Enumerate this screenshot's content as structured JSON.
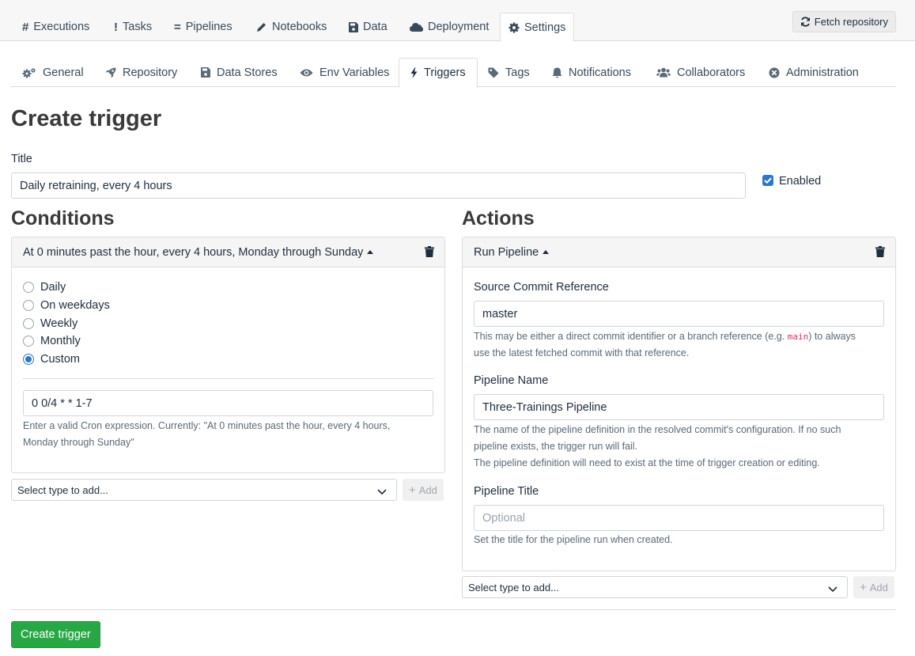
{
  "top_nav": {
    "tabs": [
      {
        "label": "Executions",
        "icon": "hash-icon"
      },
      {
        "label": "Tasks",
        "icon": "exclamation-icon"
      },
      {
        "label": "Pipelines",
        "icon": "equals-icon"
      },
      {
        "label": "Notebooks",
        "icon": "pencil-icon"
      },
      {
        "label": "Data",
        "icon": "floppy-disk-icon"
      },
      {
        "label": "Deployment",
        "icon": "cloud-icon"
      },
      {
        "label": "Settings",
        "icon": "gear-icon"
      }
    ],
    "active": "Settings",
    "fetch_button": "Fetch repository"
  },
  "settings_nav": {
    "tabs": [
      {
        "label": "General",
        "icon": "gears-icon"
      },
      {
        "label": "Repository",
        "icon": "rocket-icon"
      },
      {
        "label": "Data Stores",
        "icon": "floppy-disk-icon"
      },
      {
        "label": "Env Variables",
        "icon": "eye-icon"
      },
      {
        "label": "Triggers",
        "icon": "bolt-icon"
      },
      {
        "label": "Tags",
        "icon": "tag-icon"
      },
      {
        "label": "Notifications",
        "icon": "bell-icon"
      },
      {
        "label": "Collaborators",
        "icon": "users-icon"
      },
      {
        "label": "Administration",
        "icon": "circle-x-icon"
      }
    ],
    "active": "Triggers"
  },
  "page": {
    "title": "Create trigger",
    "title_label": "Title",
    "title_value": "Daily retraining, every 4 hours",
    "enabled_label": "Enabled",
    "enabled": true
  },
  "conditions": {
    "heading": "Conditions",
    "card_title": "At 0 minutes past the hour, every 4 hours, Monday through Sunday",
    "options": [
      "Daily",
      "On weekdays",
      "Weekly",
      "Monthly",
      "Custom"
    ],
    "selected": "Custom",
    "cron_value": "0 0/4 * * 1-7",
    "help_line1": "Enter a valid Cron expression. Currently: \"At 0 minutes past the hour, every 4 hours,",
    "help_line2": "Monday through Sunday\"",
    "select_placeholder": "Select type to add...",
    "add_label": "Add"
  },
  "actions": {
    "heading": "Actions",
    "card_title": "Run Pipeline",
    "source_label": "Source Commit Reference",
    "source_value": "master",
    "source_help_pre": "This may be either a direct commit identifier or a branch reference (e.g. ",
    "source_help_code": "main",
    "source_help_post": ") to always",
    "source_help_line2": "use the latest fetched commit with that reference.",
    "pipeline_name_label": "Pipeline Name",
    "pipeline_name_value": "Three-Trainings Pipeline",
    "pipeline_help_line1": "The name of the pipeline definition in the resolved commit's configuration. If no such",
    "pipeline_help_line2": "pipeline exists, the trigger run will fail.",
    "pipeline_help_line3": "The pipeline definition will need to exist at the time of trigger creation or editing.",
    "pipeline_title_label": "Pipeline Title",
    "pipeline_title_placeholder": "Optional",
    "pipeline_title_help": "Set the title for the pipeline run when created.",
    "select_placeholder": "Select type to add...",
    "add_label": "Add"
  },
  "submit_label": "Create trigger"
}
